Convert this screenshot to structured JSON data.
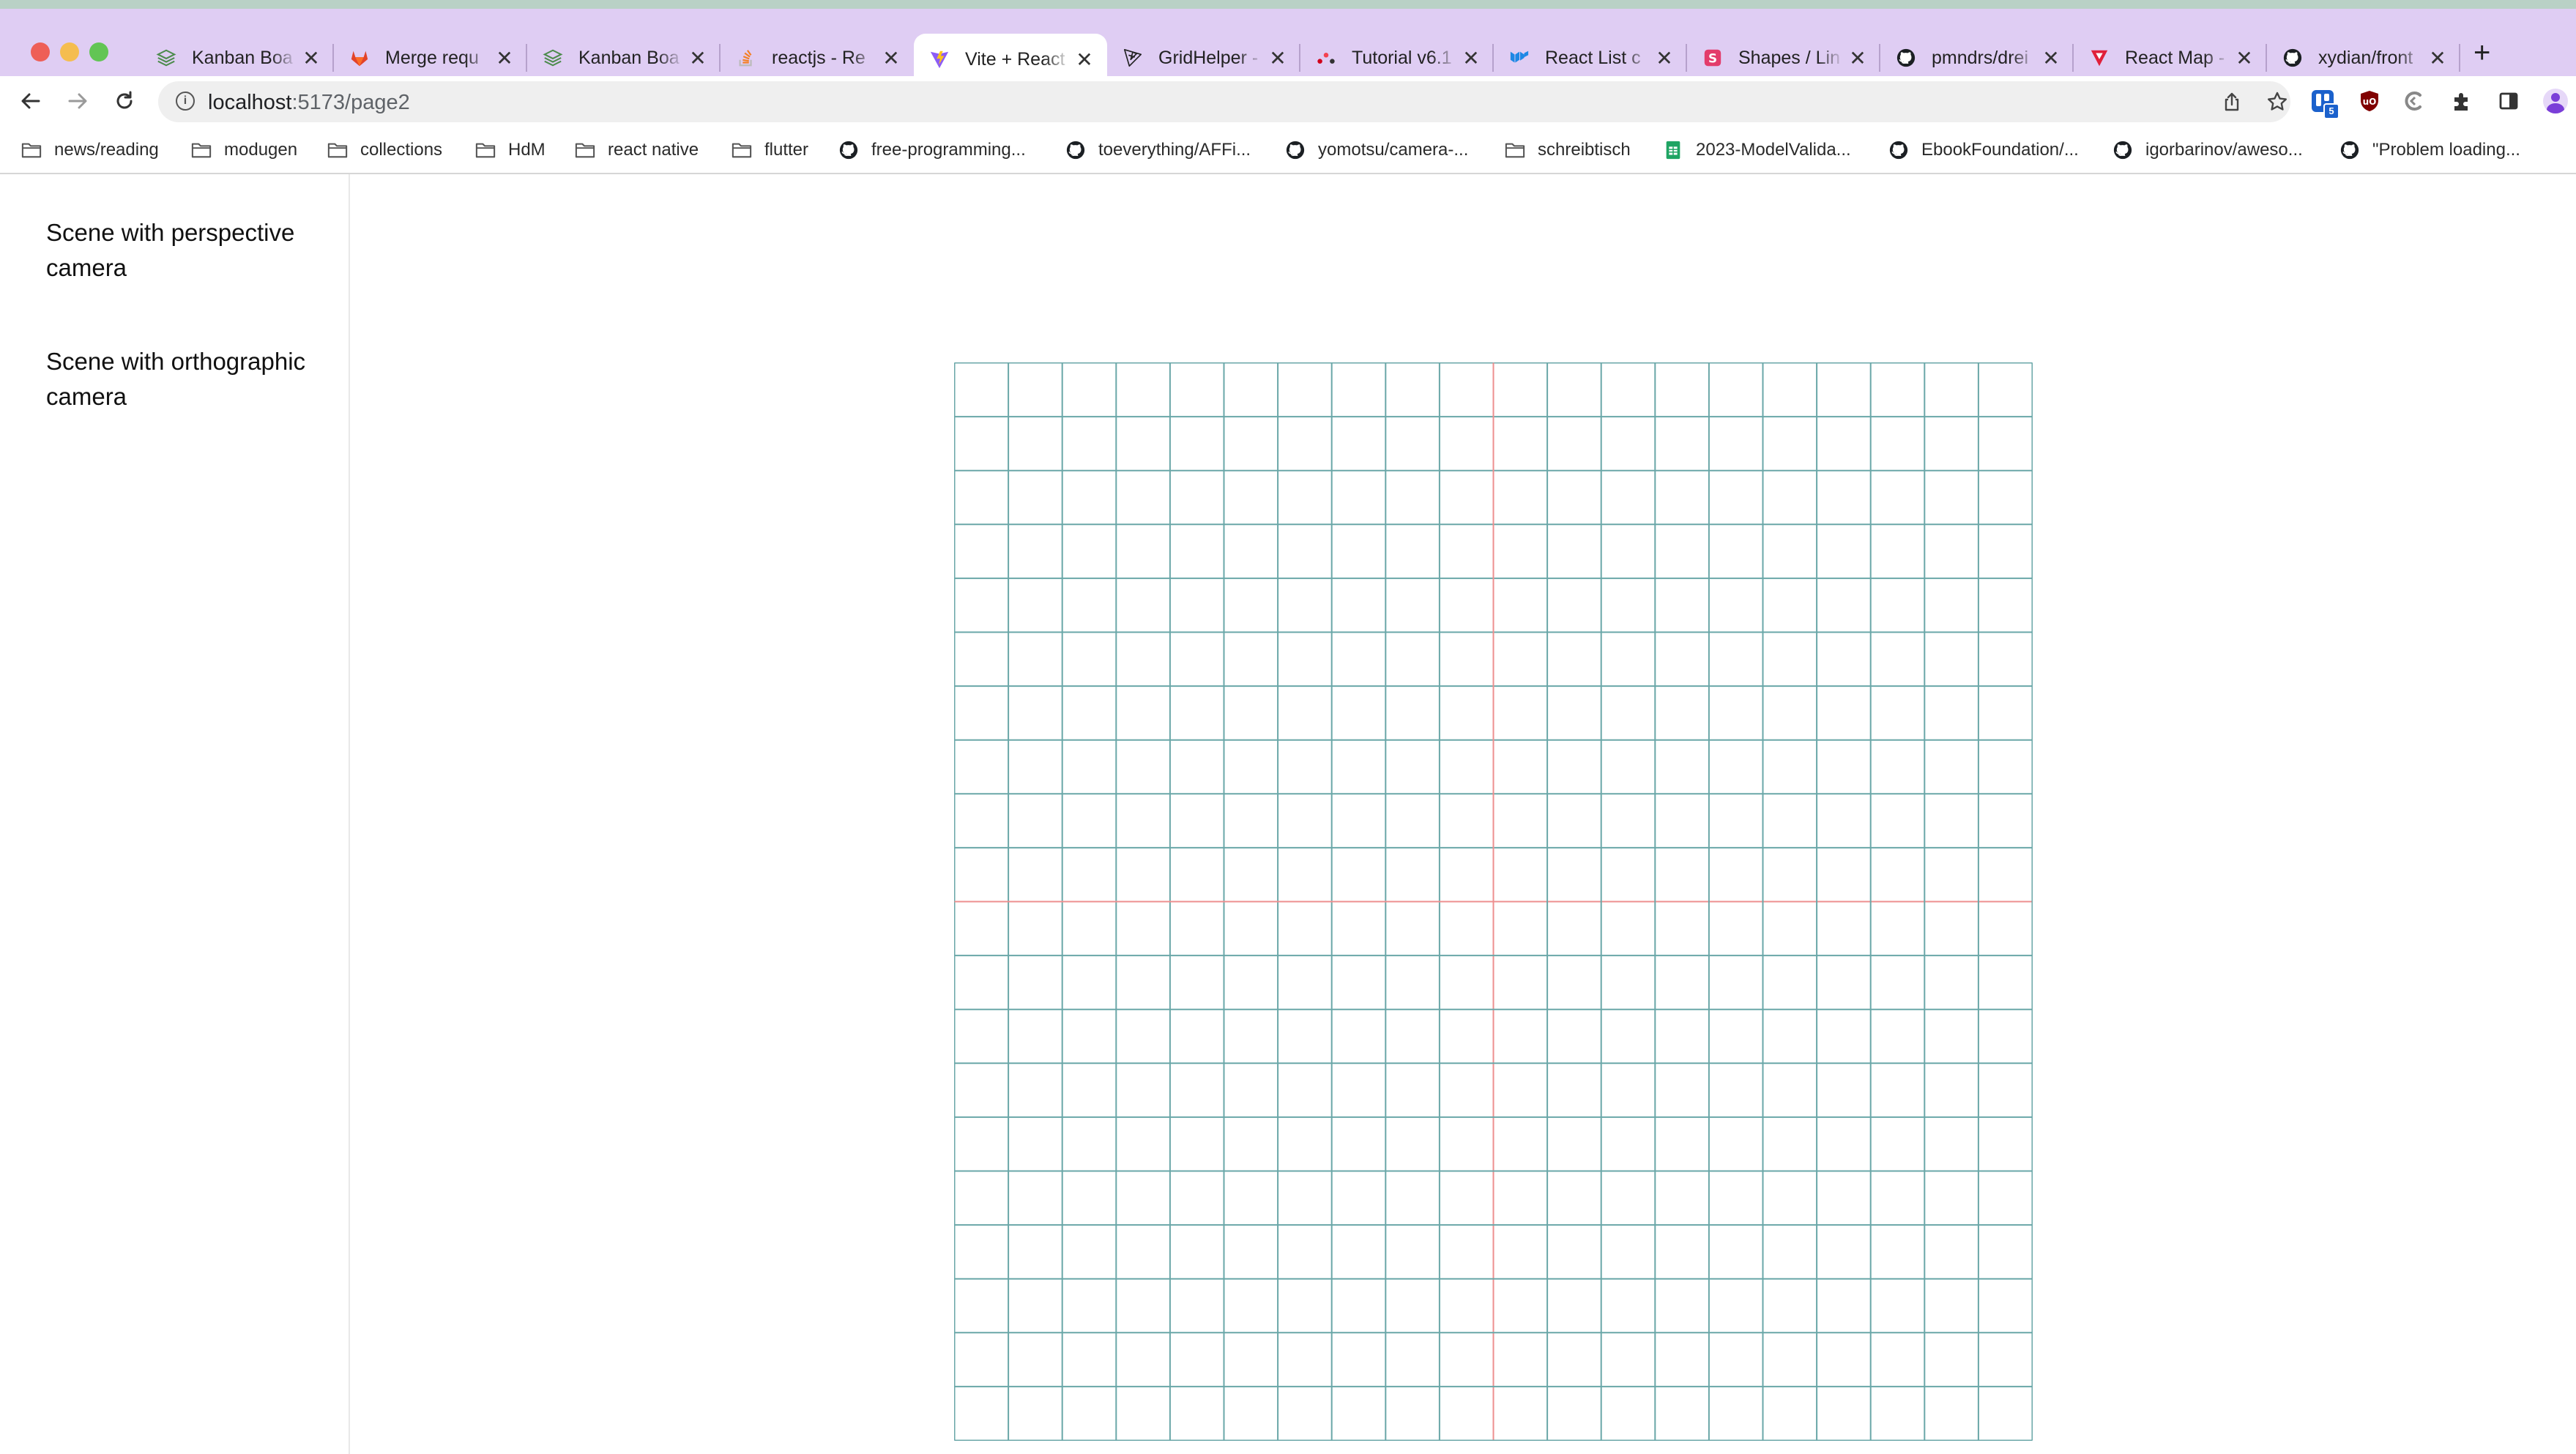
{
  "window": {
    "traffic_lights": [
      "#ee5f57",
      "#f5bd4f",
      "#62c554"
    ]
  },
  "tabs": [
    {
      "title": "Kanban Boa",
      "icon": "stack-icon",
      "color": "#4d8b4d",
      "active": false
    },
    {
      "title": "Merge requ",
      "icon": "gitlab-icon",
      "color": "#e24329",
      "active": false
    },
    {
      "title": "Kanban Boa",
      "icon": "stack-icon",
      "color": "#4d8b4d",
      "active": false
    },
    {
      "title": "reactjs - Re",
      "icon": "stackoverflow-icon",
      "color": "#f48024",
      "active": false
    },
    {
      "title": "Vite + React",
      "icon": "vite-icon",
      "color": "#8c5cf6",
      "active": true
    },
    {
      "title": "GridHelper -",
      "icon": "threejs-icon",
      "color": "#222222",
      "active": false
    },
    {
      "title": "Tutorial v6.1",
      "icon": "react-router-icon",
      "color": "#d0021b",
      "active": false
    },
    {
      "title": "React List c",
      "icon": "mui-icon",
      "color": "#1e88e5",
      "active": false
    },
    {
      "title": "Shapes / Lin",
      "icon": "konva-icon",
      "color": "#e33c6b",
      "active": false
    },
    {
      "title": "pmndrs/drei",
      "icon": "github-icon",
      "color": "#111111",
      "active": false
    },
    {
      "title": "React Map -",
      "icon": "react-map-icon",
      "color": "#e0203a",
      "active": false
    },
    {
      "title": "xydian/front",
      "icon": "github-icon",
      "color": "#111111",
      "active": false
    }
  ],
  "toolbar": {
    "url_host": "localhost",
    "url_path": ":5173/page2",
    "extension_badge": "5"
  },
  "bookmarks": [
    {
      "label": "news/reading",
      "icon": "folder-icon"
    },
    {
      "label": "modugen",
      "icon": "folder-icon"
    },
    {
      "label": "collections",
      "icon": "folder-icon"
    },
    {
      "label": "HdM",
      "icon": "folder-icon"
    },
    {
      "label": "react native",
      "icon": "folder-icon"
    },
    {
      "label": "flutter",
      "icon": "folder-icon"
    },
    {
      "label": "free-programming...",
      "icon": "github-icon"
    },
    {
      "label": "toeverything/AFFi...",
      "icon": "github-icon"
    },
    {
      "label": "yomotsu/camera-...",
      "icon": "github-icon"
    },
    {
      "label": "schreibtisch",
      "icon": "folder-icon"
    },
    {
      "label": "2023-ModelValida...",
      "icon": "sheets-icon"
    },
    {
      "label": "EbookFoundation/...",
      "icon": "github-icon"
    },
    {
      "label": "igorbarinov/aweso...",
      "icon": "github-icon"
    },
    {
      "label": "\"Problem loading...",
      "icon": "github-icon"
    }
  ],
  "sidebar": {
    "links": [
      {
        "label": "Scene with perspective camera"
      },
      {
        "label": "Scene with orthographic camera"
      }
    ]
  },
  "grid": {
    "divisions": 20,
    "line_color": "#6aa7a8",
    "center_line_color": "#ee8f8f"
  }
}
